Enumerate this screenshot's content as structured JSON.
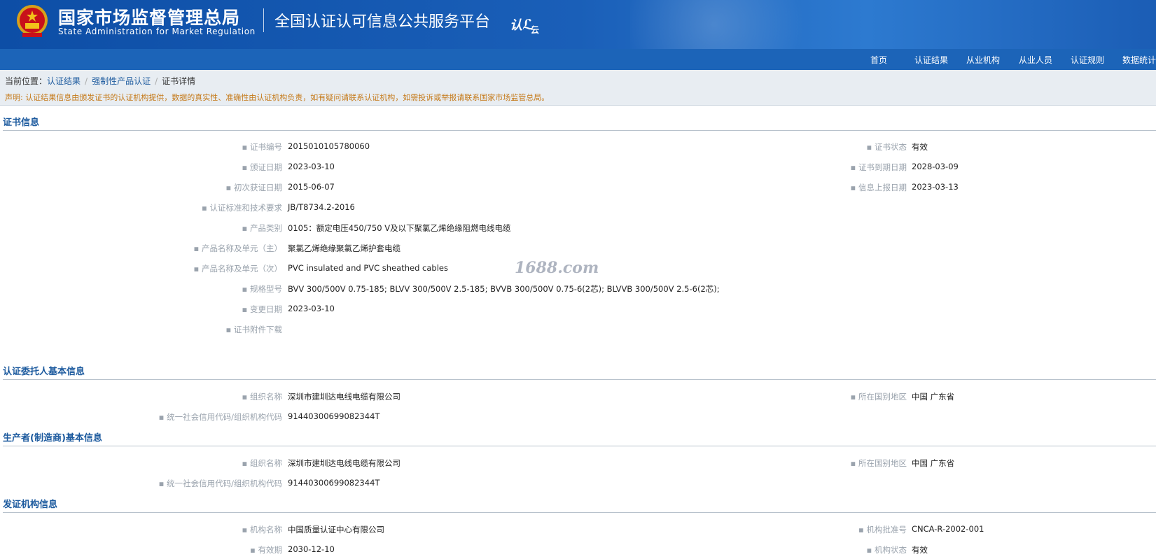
{
  "header": {
    "agency_cn": "国家市场监督管理总局",
    "agency_en": "State Administration  for  Market Regulation",
    "platform_title": "全国认证认可信息公共服务平台",
    "logo_text": "认",
    "logo_sub": "云"
  },
  "nav": {
    "items": [
      "首页",
      "认证结果",
      "从业机构",
      "从业人员",
      "认证规则",
      "数据统计"
    ]
  },
  "breadcrumb": {
    "prefix": "当前位置：",
    "items": [
      "认证结果",
      "强制性产品认证",
      "证书详情"
    ]
  },
  "notice": "声明: 认证结果信息由颁发证书的认证机构提供，数据的真实性、准确性由认证机构负责，如有疑问请联系认证机构，如需投诉或举报请联系国家市场监管总局。",
  "watermark": "1688.com",
  "cert": {
    "title": "证书信息",
    "rows": [
      {
        "label": "证书编号",
        "value": "2015010105780060"
      },
      {
        "label": "颁证日期",
        "value": "2023-03-10"
      },
      {
        "label": "初次获证日期",
        "value": "2015-06-07"
      },
      {
        "label": "认证标准和技术要求",
        "value": "JB/T8734.2-2016"
      },
      {
        "label": "产品类别",
        "value": "0105：额定电压450/750 V及以下聚氯乙烯绝缘阻燃电线电缆"
      },
      {
        "label": "产品名称及单元（主）",
        "value": "聚氯乙烯绝缘聚氯乙烯护套电缆"
      },
      {
        "label": "产品名称及单元（次）",
        "value": "PVC insulated and PVC sheathed cables"
      },
      {
        "label": "规格型号",
        "value": "BVV 300/500V 0.75-185; BLVV 300/500V 2.5-185; BVVB 300/500V 0.75-6(2芯); BLVVB 300/500V 2.5-6(2芯);"
      },
      {
        "label": "变更日期",
        "value": "2023-03-10"
      },
      {
        "label": "证书附件下载",
        "value": ""
      }
    ],
    "right_rows": [
      {
        "label": "证书状态",
        "value": "有效"
      },
      {
        "label": "证书到期日期",
        "value": "2028-03-09"
      },
      {
        "label": "信息上报日期",
        "value": "2023-03-13"
      }
    ]
  },
  "client": {
    "title": "认证委托人基本信息",
    "org_label": "组织名称",
    "org_value": "深圳市建圳达电线电缆有限公司",
    "code_label": "统一社会信用代码/组织机构代码",
    "code_value": "91440300699082344T",
    "region_label": "所在国别地区",
    "region_value": "中国 广东省"
  },
  "producer": {
    "title": "生产者(制造商)基本信息",
    "org_label": "组织名称",
    "org_value": "深圳市建圳达电线电缆有限公司",
    "code_label": "统一社会信用代码/组织机构代码",
    "code_value": "91440300699082344T",
    "region_label": "所在国别地区",
    "region_value": "中国 广东省"
  },
  "issuer": {
    "title": "发证机构信息",
    "org_label": "机构名称",
    "org_value": "中国质量认证中心有限公司",
    "valid_label": "有效期",
    "valid_value": "2030-12-10",
    "approval_label": "机构批准号",
    "approval_value": "CNCA-R-2002-001",
    "status_label": "机构状态",
    "status_value": "有效"
  },
  "colors": {
    "header_blue": "#1a5fb8",
    "nav_blue": "#1c64b8",
    "section_title": "#1c5a9e",
    "notice_orange": "#c57a1a",
    "label_gray": "#9aa3ad"
  }
}
